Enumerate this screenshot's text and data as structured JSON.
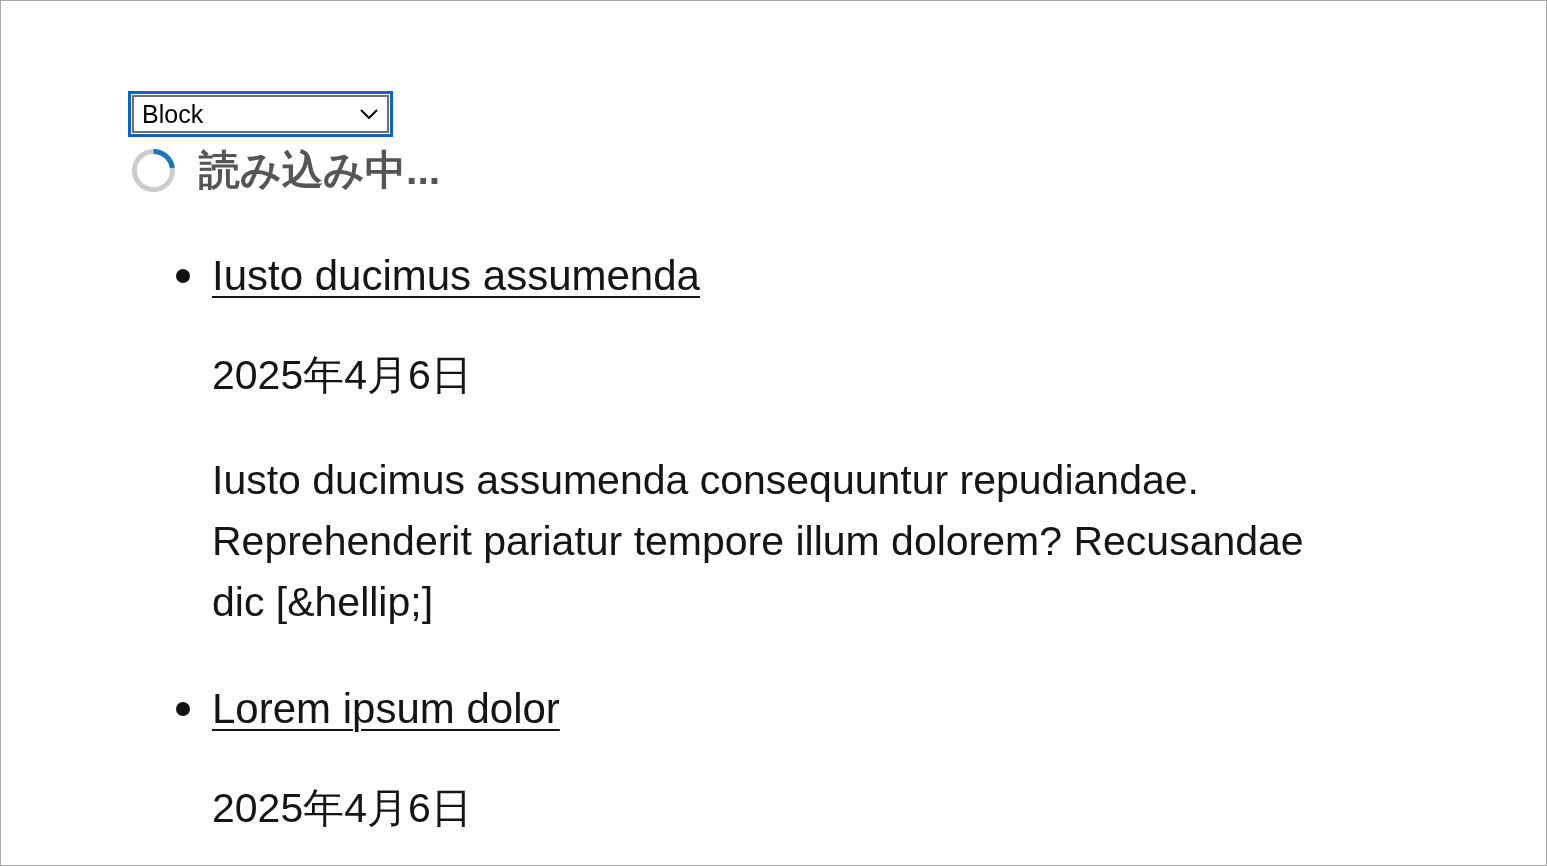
{
  "dropdown": {
    "value": "Block",
    "focused": true
  },
  "loading": {
    "label": "読み込み中..."
  },
  "posts": [
    {
      "title": "Iusto ducimus assumenda",
      "date": "2025年4月6日",
      "excerpt": "Iusto ducimus assumenda consequuntur repudiandae. Reprehenderit pariatur tempore illum dolorem? Recusandae dic [&hellip;]"
    },
    {
      "title": "Lorem ipsum dolor",
      "date": "2025年4月6日"
    }
  ]
}
